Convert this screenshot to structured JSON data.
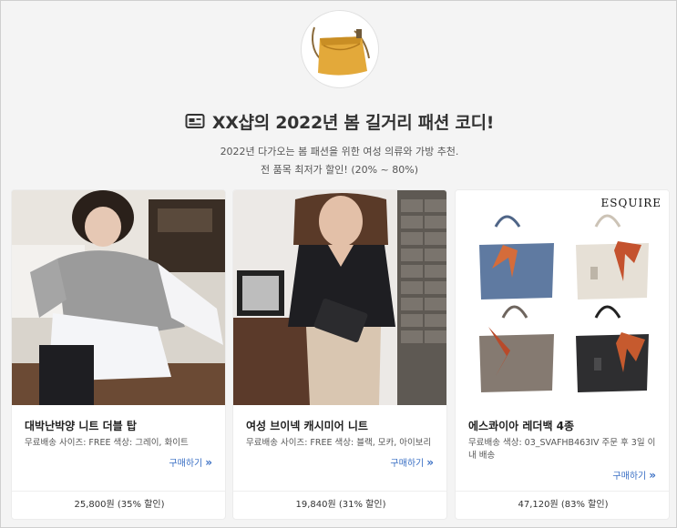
{
  "header": {
    "logo_icon": "yellow-bag-icon",
    "title_icon": "card-icon",
    "title": "XX샵의 2022년 봄 길거리 패션 코디!",
    "subtitle_line1": "2022년 다가오는 봄 패션을 위한 여성 의류와 가방 추천.",
    "subtitle_line2": "전 품목 최저가 할인! (20% ~ 80%)"
  },
  "products": [
    {
      "name": "대박난박양 니트 더블 탑",
      "desc": "무료배송 사이즈: FREE 색상: 그레이, 화이트",
      "buy": "구매하기",
      "price": "25,800원 (35% 할인)"
    },
    {
      "name": "여성 브이넥 캐시미어 니트",
      "desc": "무료배송 사이즈: FREE 색상: 블랙, 모카, 아이보리",
      "buy": "구매하기",
      "price": "19,840원 (31% 할인)"
    },
    {
      "name": "에스콰이아 레더백 4종",
      "desc": "무료배송 색상: 03_SVAFHB463IV 주문 후 3일 이내 배송",
      "buy": "구매하기",
      "price": "47,120원 (83% 할인)",
      "brand": "ESQUIRE"
    }
  ],
  "colors": {
    "accent": "#3a6fc4",
    "bag_yellow": "#e3a93a"
  }
}
